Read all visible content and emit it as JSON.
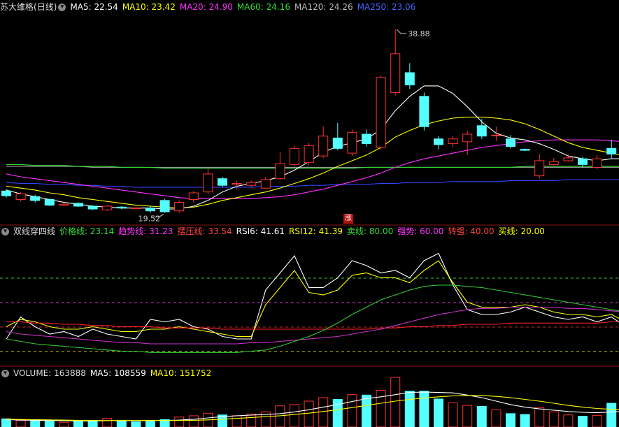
{
  "colors": {
    "up": "#ff3333",
    "down": "#54ffff",
    "ma5": "#ffffff",
    "ma10": "#ffff00",
    "ma20": "#ff33ff",
    "ma60": "#33dd33",
    "ma120": "#999999",
    "ma250": "#3344ff",
    "price": "#ffffff",
    "trend": "#ffff00",
    "rsi6": "#ffffff",
    "rsi12": "#ffff00",
    "long": "#ff2222",
    "mid": "#cc33cc",
    "slow": "#33cc33"
  },
  "panel1": {
    "stock": "苏大维格",
    "period": "(日线)",
    "ma5": "MA5: 22.54",
    "ma10": "MA10: 23.42",
    "ma20": "MA20: 24.90",
    "ma60": "MA60: 24.16",
    "ma120": "MA120: 24.26",
    "ma250": "MA250: 23.06",
    "high_label": "38.88",
    "low_label": "19.52",
    "marker": "涨"
  },
  "panel2": {
    "title": "双线穿四线",
    "price_line": "价格线: 23.14",
    "trend_line": "趋势线: 31.23",
    "pressure_line": "摆压线: 33.54",
    "rsi6": "RSI6: 41.61",
    "rsi12": "RSI12: 41.39",
    "sell_line": "卖线: 80.00",
    "strong_line": "强势: 60.00",
    "turn_line": "转强: 40.00",
    "buy_line": "买线: 20.00"
  },
  "panel3": {
    "volume": "VOLUME: 163888",
    "ma5": "MA5: 108559",
    "ma10": "MA10: 151752"
  },
  "chart_data": [
    {
      "type": "candlestick",
      "ylim": [
        18.5,
        40.5
      ],
      "candles": [
        {
          "o": 21.8,
          "c": 21.3,
          "h": 22.0,
          "l": 21.1
        },
        {
          "o": 20.9,
          "c": 21.5,
          "h": 21.7,
          "l": 20.7
        },
        {
          "o": 21.2,
          "c": 20.8,
          "h": 21.4,
          "l": 20.6
        },
        {
          "o": 20.9,
          "c": 20.3,
          "h": 21.0,
          "l": 20.2
        },
        {
          "o": 20.3,
          "c": 20.4,
          "h": 20.5,
          "l": 20.2
        },
        {
          "o": 20.5,
          "c": 20.2,
          "h": 20.6,
          "l": 20.1
        },
        {
          "o": 20.2,
          "c": 19.9,
          "h": 20.3,
          "l": 19.8
        },
        {
          "o": 19.8,
          "c": 20.2,
          "h": 20.3,
          "l": 19.7
        },
        {
          "o": 20.1,
          "c": 20.0,
          "h": 20.2,
          "l": 19.9
        },
        {
          "o": 20.0,
          "c": 20.0,
          "h": 20.1,
          "l": 19.9
        },
        {
          "o": 20.0,
          "c": 19.7,
          "h": 20.2,
          "l": 19.5
        },
        {
          "o": 20.8,
          "c": 19.6,
          "h": 21.0,
          "l": 19.5
        },
        {
          "o": 19.7,
          "c": 20.6,
          "h": 20.8,
          "l": 19.5
        },
        {
          "o": 20.9,
          "c": 21.6,
          "h": 21.8,
          "l": 20.6
        },
        {
          "o": 21.7,
          "c": 23.6,
          "h": 24.2,
          "l": 21.5
        },
        {
          "o": 23.1,
          "c": 22.4,
          "h": 23.3,
          "l": 22.2
        },
        {
          "o": 22.5,
          "c": 22.6,
          "h": 22.9,
          "l": 22.0
        },
        {
          "o": 22.4,
          "c": 22.7,
          "h": 22.9,
          "l": 22.2
        },
        {
          "o": 22.1,
          "c": 23.0,
          "h": 23.3,
          "l": 22.0
        },
        {
          "o": 23.1,
          "c": 24.7,
          "h": 25.9,
          "l": 23.0
        },
        {
          "o": 24.6,
          "c": 26.3,
          "h": 26.6,
          "l": 24.4
        },
        {
          "o": 24.8,
          "c": 26.6,
          "h": 26.9,
          "l": 24.5
        },
        {
          "o": 25.5,
          "c": 27.6,
          "h": 28.6,
          "l": 25.3
        },
        {
          "o": 27.4,
          "c": 26.3,
          "h": 29.0,
          "l": 26.1
        },
        {
          "o": 25.8,
          "c": 28.0,
          "h": 28.3,
          "l": 25.5
        },
        {
          "o": 27.8,
          "c": 26.8,
          "h": 28.3,
          "l": 26.5
        },
        {
          "o": 26.4,
          "c": 33.8,
          "h": 34.0,
          "l": 26.2
        },
        {
          "o": 32.2,
          "c": 36.3,
          "h": 38.88,
          "l": 31.9
        },
        {
          "o": 34.3,
          "c": 33.0,
          "h": 35.3,
          "l": 32.6
        },
        {
          "o": 31.8,
          "c": 28.6,
          "h": 32.2,
          "l": 28.2
        },
        {
          "o": 27.3,
          "c": 26.7,
          "h": 27.6,
          "l": 26.2
        },
        {
          "o": 26.8,
          "c": 27.3,
          "h": 27.6,
          "l": 26.4
        },
        {
          "o": 27.0,
          "c": 27.8,
          "h": 28.2,
          "l": 25.6
        },
        {
          "o": 28.7,
          "c": 27.6,
          "h": 29.4,
          "l": 27.3
        },
        {
          "o": 27.7,
          "c": 27.7,
          "h": 28.6,
          "l": 27.1
        },
        {
          "o": 27.3,
          "c": 26.5,
          "h": 27.7,
          "l": 26.3
        },
        {
          "o": 26.2,
          "c": 26.1,
          "h": 26.3,
          "l": 26.0
        },
        {
          "o": 23.4,
          "c": 25.0,
          "h": 25.7,
          "l": 23.1
        },
        {
          "o": 24.6,
          "c": 24.9,
          "h": 25.3,
          "l": 24.5
        },
        {
          "o": 25.0,
          "c": 25.3,
          "h": 25.7,
          "l": 24.9
        },
        {
          "o": 25.2,
          "c": 24.6,
          "h": 25.4,
          "l": 24.3
        },
        {
          "o": 24.3,
          "c": 25.2,
          "h": 25.6,
          "l": 24.1
        },
        {
          "o": 26.3,
          "c": 25.7,
          "h": 27.2,
          "l": 25.2
        },
        {
          "o": 24.9,
          "c": 24.6,
          "h": 25.7,
          "l": 24.4
        },
        {
          "o": 24.4,
          "c": 23.8,
          "h": 24.6,
          "l": 23.5
        },
        {
          "o": 23.2,
          "c": 23.1,
          "h": 23.4,
          "l": 23.0
        }
      ],
      "ma5": [
        21.9,
        21.5,
        21.2,
        20.9,
        20.6,
        20.4,
        20.2,
        20.1,
        20.0,
        20.0,
        20.0,
        19.9,
        19.9,
        20.2,
        20.8,
        21.7,
        22.3,
        22.6,
        22.9,
        23.3,
        24.0,
        24.9,
        25.9,
        26.5,
        26.9,
        27.3,
        28.3,
        30.3,
        31.8,
        32.9,
        32.9,
        32.1,
        30.7,
        29.1,
        27.9,
        27.4,
        27.2,
        26.8,
        26.2,
        25.5,
        25.2,
        25.0,
        25.2,
        25.2,
        25.0,
        24.8
      ],
      "ma10": [
        22.3,
        22.1,
        21.9,
        21.6,
        21.4,
        21.1,
        20.9,
        20.7,
        20.5,
        20.3,
        20.2,
        20.1,
        20.0,
        20.1,
        20.4,
        20.8,
        21.1,
        21.4,
        21.7,
        22.1,
        22.6,
        23.1,
        23.7,
        24.4,
        25.0,
        25.6,
        26.4,
        27.5,
        28.2,
        28.8,
        29.2,
        29.5,
        29.6,
        29.6,
        29.5,
        29.3,
        28.9,
        28.3,
        27.6,
        26.9,
        26.4,
        26.1,
        25.8,
        25.5,
        25.1,
        24.8
      ],
      "ma20": [
        23.6,
        23.3,
        23.1,
        22.9,
        22.7,
        22.5,
        22.3,
        22.1,
        21.9,
        21.7,
        21.5,
        21.3,
        21.1,
        21.0,
        21.0,
        21.0,
        21.0,
        21.0,
        21.1,
        21.2,
        21.4,
        21.7,
        22.0,
        22.4,
        22.8,
        23.2,
        23.7,
        24.3,
        24.8,
        25.2,
        25.5,
        25.8,
        26.1,
        26.4,
        26.6,
        26.8,
        27.0,
        27.1,
        27.2,
        27.2,
        27.2,
        27.2,
        27.1,
        27.0,
        26.8,
        26.6
      ],
      "ma60": [
        24.6,
        24.6,
        24.5,
        24.5,
        24.5,
        24.4,
        24.4,
        24.4,
        24.3,
        24.3,
        24.3,
        24.2,
        24.2,
        24.2,
        24.2,
        24.2,
        24.2,
        24.2,
        24.2,
        24.2,
        24.2,
        24.2,
        24.2,
        24.2,
        24.2,
        24.3,
        24.3,
        24.3,
        24.3,
        24.3,
        24.3,
        24.3,
        24.3,
        24.3,
        24.3,
        24.3,
        24.4,
        24.4,
        24.4,
        24.4,
        24.4,
        24.4,
        24.4,
        24.4,
        24.4,
        24.4
      ],
      "ma120": [
        24.4,
        24.4,
        24.4,
        24.4,
        24.4,
        24.4,
        24.3,
        24.3,
        24.3,
        24.3,
        24.3,
        24.3,
        24.3,
        24.3,
        24.3,
        24.3,
        24.3,
        24.3,
        24.3,
        24.3,
        24.3,
        24.3,
        24.3,
        24.3,
        24.3,
        24.3,
        24.3,
        24.3,
        24.3,
        24.3,
        24.3,
        24.3,
        24.3,
        24.3,
        24.3,
        24.3,
        24.3,
        24.3,
        24.3,
        24.3,
        24.3,
        24.3,
        24.3,
        24.3,
        24.3,
        24.3
      ],
      "ma250": [
        22.7,
        22.6,
        22.6,
        22.5,
        22.5,
        22.4,
        22.4,
        22.3,
        22.3,
        22.2,
        22.2,
        22.2,
        22.2,
        22.2,
        22.2,
        22.2,
        22.2,
        22.2,
        22.3,
        22.3,
        22.3,
        22.4,
        22.4,
        22.5,
        22.5,
        22.5,
        22.6,
        22.6,
        22.7,
        22.7,
        22.7,
        22.8,
        22.8,
        22.8,
        22.8,
        22.9,
        22.9,
        22.9,
        22.9,
        23.0,
        23.0,
        23.0,
        23.0,
        23.0,
        23.1,
        23.1
      ]
    },
    {
      "type": "line",
      "ylim": [
        0,
        100
      ],
      "reference_lines": [
        80,
        60,
        40,
        20
      ],
      "series": [
        {
          "name": "价格线",
          "color": "price",
          "values": [
            20,
            38,
            30,
            24,
            26,
            22,
            28,
            24,
            22,
            20,
            36,
            34,
            36,
            30,
            28,
            22,
            20,
            20,
            60,
            74,
            88,
            62,
            62,
            70,
            84,
            80,
            74,
            76,
            70,
            84,
            90,
            64,
            44,
            40,
            40,
            42,
            46,
            42,
            38,
            36,
            38,
            34,
            38,
            30,
            28,
            26
          ]
        },
        {
          "name": "趋势线",
          "color": "trend",
          "values": [
            30,
            36,
            34,
            30,
            28,
            28,
            30,
            28,
            26,
            26,
            28,
            28,
            30,
            28,
            26,
            24,
            22,
            22,
            48,
            62,
            76,
            58,
            56,
            60,
            72,
            74,
            70,
            70,
            66,
            76,
            84,
            66,
            50,
            46,
            46,
            46,
            48,
            46,
            42,
            40,
            40,
            38,
            40,
            34,
            32,
            30
          ]
        },
        {
          "name": "摆压线",
          "color": "long",
          "values": [
            34,
            34,
            33,
            33,
            32,
            32,
            31,
            31,
            30,
            30,
            30,
            29,
            29,
            29,
            29,
            28,
            28,
            28,
            28,
            28,
            28,
            28,
            28,
            28,
            28,
            28,
            29,
            29,
            30,
            30,
            31,
            31,
            32,
            32,
            32,
            33,
            33,
            33,
            33,
            33,
            33,
            33,
            34,
            34,
            34,
            34
          ]
        },
        {
          "name": "mid",
          "color": "mid",
          "values": [
            26,
            24,
            23,
            22,
            21,
            20,
            19,
            18,
            17,
            17,
            16,
            16,
            16,
            16,
            16,
            16,
            16,
            17,
            17,
            18,
            19,
            20,
            21,
            22,
            24,
            26,
            28,
            31,
            34,
            37,
            40,
            42,
            44,
            45,
            45,
            46,
            46,
            46,
            46,
            45,
            45,
            44,
            43,
            42,
            41,
            40
          ]
        },
        {
          "name": "slow",
          "color": "slow",
          "values": [
            20,
            18,
            16,
            15,
            14,
            13,
            12,
            11,
            10,
            10,
            9,
            9,
            9,
            9,
            9,
            9,
            9,
            10,
            11,
            14,
            18,
            22,
            27,
            33,
            40,
            46,
            52,
            56,
            60,
            63,
            64,
            64,
            63,
            62,
            60,
            58,
            56,
            54,
            52,
            50,
            48,
            46,
            44,
            42,
            40,
            38
          ]
        }
      ]
    },
    {
      "type": "bar",
      "ylim": [
        0,
        230000
      ],
      "values": [
        {
          "v": 38000,
          "up": false
        },
        {
          "v": 30000,
          "up": true
        },
        {
          "v": 33000,
          "up": false
        },
        {
          "v": 28000,
          "up": false
        },
        {
          "v": 22000,
          "up": true
        },
        {
          "v": 26000,
          "up": false
        },
        {
          "v": 30000,
          "up": false
        },
        {
          "v": 40000,
          "up": true
        },
        {
          "v": 28000,
          "up": false
        },
        {
          "v": 24000,
          "up": false
        },
        {
          "v": 30000,
          "up": false
        },
        {
          "v": 34000,
          "up": false
        },
        {
          "v": 46000,
          "up": true
        },
        {
          "v": 52000,
          "up": true
        },
        {
          "v": 64000,
          "up": true
        },
        {
          "v": 56000,
          "up": false
        },
        {
          "v": 52000,
          "up": true
        },
        {
          "v": 60000,
          "up": true
        },
        {
          "v": 70000,
          "up": true
        },
        {
          "v": 98000,
          "up": true
        },
        {
          "v": 104000,
          "up": true
        },
        {
          "v": 120000,
          "up": true
        },
        {
          "v": 136000,
          "up": true
        },
        {
          "v": 128000,
          "up": false
        },
        {
          "v": 150000,
          "up": true
        },
        {
          "v": 148000,
          "up": false
        },
        {
          "v": 170000,
          "up": true
        },
        {
          "v": 230000,
          "up": true
        },
        {
          "v": 166000,
          "up": false
        },
        {
          "v": 166000,
          "up": false
        },
        {
          "v": 130000,
          "up": false
        },
        {
          "v": 112000,
          "up": true
        },
        {
          "v": 100000,
          "up": true
        },
        {
          "v": 96000,
          "up": false
        },
        {
          "v": 80000,
          "up": true
        },
        {
          "v": 62000,
          "up": false
        },
        {
          "v": 58000,
          "up": false
        },
        {
          "v": 90000,
          "up": true
        },
        {
          "v": 70000,
          "up": true
        },
        {
          "v": 56000,
          "up": true
        },
        {
          "v": 50000,
          "up": false
        },
        {
          "v": 54000,
          "up": true
        },
        {
          "v": 110000,
          "up": false
        },
        {
          "v": 70000,
          "up": false
        },
        {
          "v": 64000,
          "up": false
        },
        {
          "v": 52000,
          "up": false
        }
      ],
      "ma5": [
        34000,
        32000,
        31000,
        30000,
        29000,
        28000,
        28000,
        29000,
        29000,
        29000,
        30000,
        30000,
        32000,
        36000,
        42000,
        48000,
        52000,
        55000,
        58000,
        62000,
        70000,
        80000,
        92000,
        104000,
        118000,
        132000,
        140000,
        150000,
        160000,
        162000,
        160000,
        158000,
        148000,
        136000,
        120000,
        104000,
        92000,
        84000,
        78000,
        72000,
        68000,
        66000,
        70000,
        72000,
        72000,
        70000
      ],
      "ma10": [
        36000,
        35000,
        34000,
        33000,
        32000,
        31000,
        30000,
        30000,
        30000,
        30000,
        30000,
        30000,
        30000,
        31000,
        33000,
        36000,
        40000,
        44000,
        48000,
        52000,
        58000,
        64000,
        72000,
        80000,
        90000,
        100000,
        110000,
        120000,
        128000,
        134000,
        140000,
        144000,
        146000,
        146000,
        142000,
        136000,
        128000,
        120000,
        110000,
        100000,
        92000,
        86000,
        82000,
        80000,
        78000,
        76000
      ]
    }
  ]
}
